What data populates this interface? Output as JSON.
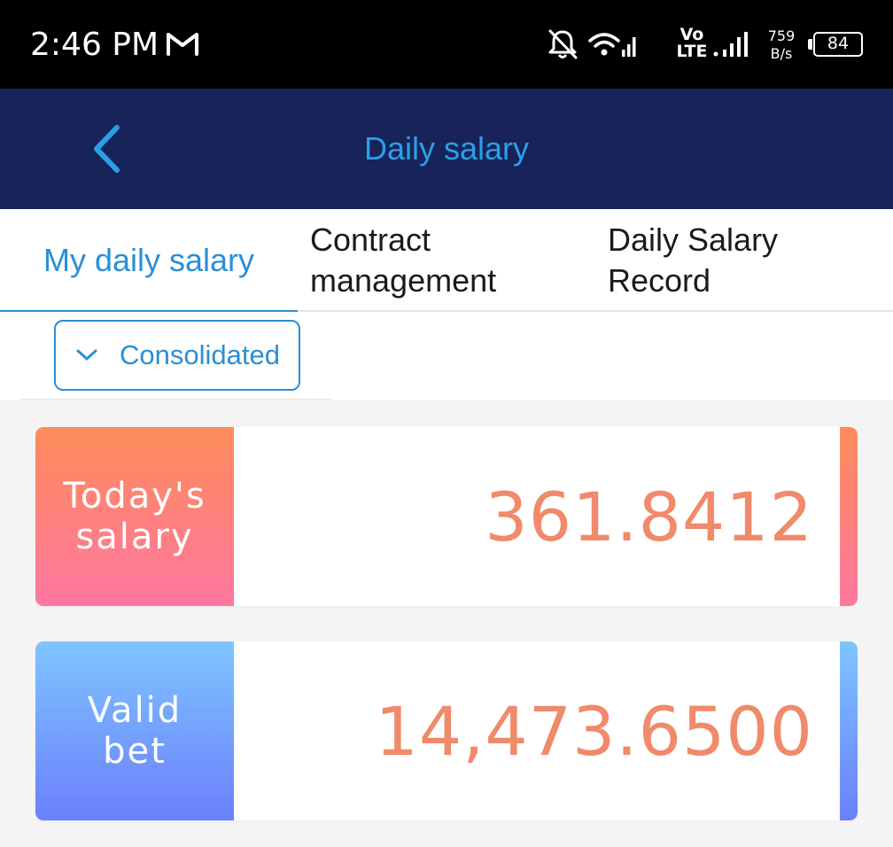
{
  "status_bar": {
    "time": "2:46 PM",
    "lte_top": "Vo",
    "lte_bottom": "LTE",
    "speed_value": "759",
    "speed_unit": "B/s",
    "battery": "84"
  },
  "header": {
    "title": "Daily salary",
    "back_icon": "chevron-left-icon"
  },
  "tabs": [
    {
      "label_line1": "My daily salary",
      "label_line2": "",
      "active": true
    },
    {
      "label_line1": "Contract",
      "label_line2": "management",
      "active": false
    },
    {
      "label_line1": "Daily Salary",
      "label_line2": "Record",
      "active": false
    }
  ],
  "filter": {
    "selected": "Consolidated"
  },
  "cards": [
    {
      "label_line1": "Today's",
      "label_line2": "salary",
      "value": "361.8412"
    },
    {
      "label_line1": "Valid",
      "label_line2": "bet",
      "value": "14,473.6500"
    }
  ],
  "colors": {
    "header_bg": "#172359",
    "accent_blue": "#2a8fd6",
    "value_color": "#f08a6a",
    "salary_gradient_top": "#fe8c5a",
    "salary_gradient_bottom": "#fe77a0",
    "bet_gradient_top": "#7ec4ff",
    "bet_gradient_bottom": "#6b80fb"
  }
}
